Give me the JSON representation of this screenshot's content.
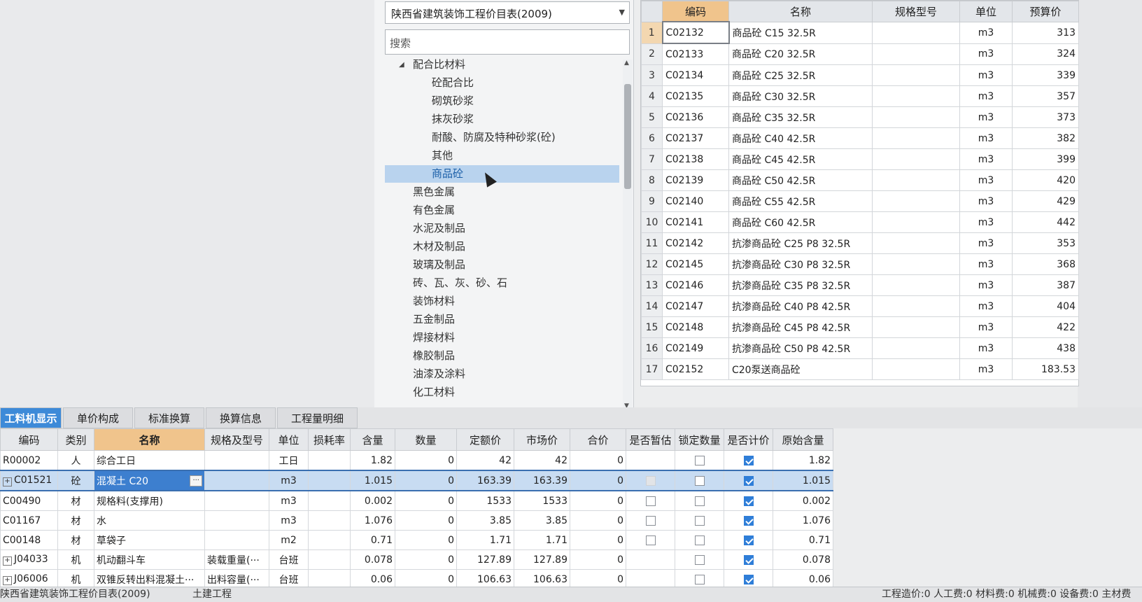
{
  "library": {
    "selected": "陕西省建筑装饰工程价目表(2009)",
    "search_placeholder": "搜索",
    "tree": {
      "root": "配合比材料",
      "children": [
        "砼配合比",
        "砌筑砂浆",
        "抹灰砂浆",
        "耐酸、防腐及特种砂浆(砼)",
        "其他",
        "商品砼"
      ],
      "selected": "商品砼",
      "siblings": [
        "黑色金属",
        "有色金属",
        "水泥及制品",
        "木材及制品",
        "玻璃及制品",
        "砖、瓦、灰、砂、石",
        "装饰材料",
        "五金制品",
        "焊接材料",
        "橡胶制品",
        "油漆及涂料",
        "化工材料"
      ]
    }
  },
  "price_table": {
    "headers": [
      "编码",
      "名称",
      "规格型号",
      "单位",
      "预算价"
    ],
    "rows": [
      {
        "n": "1",
        "code": "C02132",
        "name": "商品砼 C15 32.5R",
        "spec": "",
        "unit": "m3",
        "price": "313"
      },
      {
        "n": "2",
        "code": "C02133",
        "name": "商品砼 C20 32.5R",
        "spec": "",
        "unit": "m3",
        "price": "324"
      },
      {
        "n": "3",
        "code": "C02134",
        "name": "商品砼 C25 32.5R",
        "spec": "",
        "unit": "m3",
        "price": "339"
      },
      {
        "n": "4",
        "code": "C02135",
        "name": "商品砼 C30 32.5R",
        "spec": "",
        "unit": "m3",
        "price": "357"
      },
      {
        "n": "5",
        "code": "C02136",
        "name": "商品砼 C35 32.5R",
        "spec": "",
        "unit": "m3",
        "price": "373"
      },
      {
        "n": "6",
        "code": "C02137",
        "name": "商品砼 C40 42.5R",
        "spec": "",
        "unit": "m3",
        "price": "382"
      },
      {
        "n": "7",
        "code": "C02138",
        "name": "商品砼 C45 42.5R",
        "spec": "",
        "unit": "m3",
        "price": "399"
      },
      {
        "n": "8",
        "code": "C02139",
        "name": "商品砼 C50 42.5R",
        "spec": "",
        "unit": "m3",
        "price": "420"
      },
      {
        "n": "9",
        "code": "C02140",
        "name": "商品砼 C55 42.5R",
        "spec": "",
        "unit": "m3",
        "price": "429"
      },
      {
        "n": "10",
        "code": "C02141",
        "name": "商品砼 C60 42.5R",
        "spec": "",
        "unit": "m3",
        "price": "442"
      },
      {
        "n": "11",
        "code": "C02142",
        "name": "抗渗商品砼 C25 P8 32.5R",
        "spec": "",
        "unit": "m3",
        "price": "353"
      },
      {
        "n": "12",
        "code": "C02145",
        "name": "抗渗商品砼 C30 P8 32.5R",
        "spec": "",
        "unit": "m3",
        "price": "368"
      },
      {
        "n": "13",
        "code": "C02146",
        "name": "抗渗商品砼 C35 P8 32.5R",
        "spec": "",
        "unit": "m3",
        "price": "387"
      },
      {
        "n": "14",
        "code": "C02147",
        "name": "抗渗商品砼 C40 P8 42.5R",
        "spec": "",
        "unit": "m3",
        "price": "404"
      },
      {
        "n": "15",
        "code": "C02148",
        "name": "抗渗商品砼 C45 P8 42.5R",
        "spec": "",
        "unit": "m3",
        "price": "422"
      },
      {
        "n": "16",
        "code": "C02149",
        "name": "抗渗商品砼 C50 P8 42.5R",
        "spec": "",
        "unit": "m3",
        "price": "438"
      },
      {
        "n": "17",
        "code": "C02152",
        "name": "C20泵送商品砼",
        "spec": "",
        "unit": "m3",
        "price": "183.53"
      }
    ]
  },
  "tabs": [
    "工料机显示",
    "单价构成",
    "标准换算",
    "换算信息",
    "工程量明细"
  ],
  "active_tab": "工料机显示",
  "resource_grid": {
    "headers": [
      "编码",
      "类别",
      "名称",
      "规格及型号",
      "单位",
      "损耗率",
      "含量",
      "数量",
      "定额价",
      "市场价",
      "合价",
      "是否暂估",
      "锁定数量",
      "是否计价",
      "原始含量"
    ],
    "rows": [
      {
        "code": "R00002",
        "expand": false,
        "type": "人",
        "name": "综合工日",
        "spec": "",
        "unit": "工日",
        "loss": "",
        "content": "1.82",
        "qty": "0",
        "quota": "42",
        "market": "42",
        "total": "0",
        "estimate": "none",
        "lock": false,
        "priced": true,
        "orig": "1.82",
        "sel": false
      },
      {
        "code": "C01521",
        "expand": true,
        "type": "砼",
        "name": "混凝土 C20",
        "spec": "",
        "unit": "m3",
        "loss": "",
        "content": "1.015",
        "qty": "0",
        "quota": "163.39",
        "market": "163.39",
        "total": "0",
        "estimate": "grey",
        "lock": false,
        "priced": true,
        "orig": "1.015",
        "sel": true
      },
      {
        "code": "C00490",
        "expand": false,
        "type": "材",
        "name": "规格料(支撑用)",
        "spec": "",
        "unit": "m3",
        "loss": "",
        "content": "0.002",
        "qty": "0",
        "quota": "1533",
        "market": "1533",
        "total": "0",
        "estimate": "box",
        "lock": false,
        "priced": true,
        "orig": "0.002",
        "sel": false
      },
      {
        "code": "C01167",
        "expand": false,
        "type": "材",
        "name": "水",
        "spec": "",
        "unit": "m3",
        "loss": "",
        "content": "1.076",
        "qty": "0",
        "quota": "3.85",
        "market": "3.85",
        "total": "0",
        "estimate": "box",
        "lock": false,
        "priced": true,
        "orig": "1.076",
        "sel": false
      },
      {
        "code": "C00148",
        "expand": false,
        "type": "材",
        "name": "草袋子",
        "spec": "",
        "unit": "m2",
        "loss": "",
        "content": "0.71",
        "qty": "0",
        "quota": "1.71",
        "market": "1.71",
        "total": "0",
        "estimate": "box",
        "lock": false,
        "priced": true,
        "orig": "0.71",
        "sel": false
      },
      {
        "code": "J04033",
        "expand": true,
        "type": "机",
        "name": "机动翻斗车",
        "spec": "装载重量(···",
        "unit": "台班",
        "loss": "",
        "content": "0.078",
        "qty": "0",
        "quota": "127.89",
        "market": "127.89",
        "total": "0",
        "estimate": "none",
        "lock": false,
        "priced": true,
        "orig": "0.078",
        "sel": false
      },
      {
        "code": "J06006",
        "expand": true,
        "type": "机",
        "name": "双锥反转出料混凝土···",
        "spec": "出料容量(···",
        "unit": "台班",
        "loss": "",
        "content": "0.06",
        "qty": "0",
        "quota": "106.63",
        "market": "106.63",
        "total": "0",
        "estimate": "none",
        "lock": false,
        "priced": true,
        "orig": "0.06",
        "sel": false
      }
    ]
  },
  "status_bar": {
    "library": "陕西省建筑装饰工程价目表(2009)",
    "project": "土建工程",
    "totals": "工程造价:0  人工费:0  材料费:0  机械费:0  设备费:0  主材费"
  },
  "colors": {
    "accent": "#3d8ad8",
    "header_highlight": "#f0c48c",
    "selection": "#b9d3ee"
  }
}
